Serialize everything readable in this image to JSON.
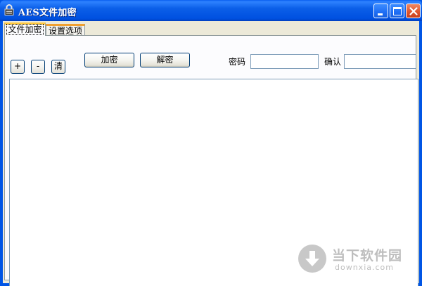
{
  "window": {
    "title": "AES文件加密"
  },
  "tabs": [
    {
      "label": "文件加密",
      "active": true
    },
    {
      "label": "设置选项",
      "active": false
    }
  ],
  "toolbar": {
    "add_label": "+",
    "remove_label": "-",
    "clear_label": "清",
    "encrypt_label": "加密",
    "decrypt_label": "解密",
    "password_label": "密码",
    "password_value": "",
    "confirm_label": "确认",
    "confirm_value": ""
  },
  "watermark": {
    "title": "当下软件园",
    "subtitle": "downxia.com"
  },
  "colors": {
    "titlebar": "#0055e5",
    "client_bg": "#ece9d8",
    "close_button": "#e0562e",
    "tab_highlight": "#ffc83c"
  }
}
